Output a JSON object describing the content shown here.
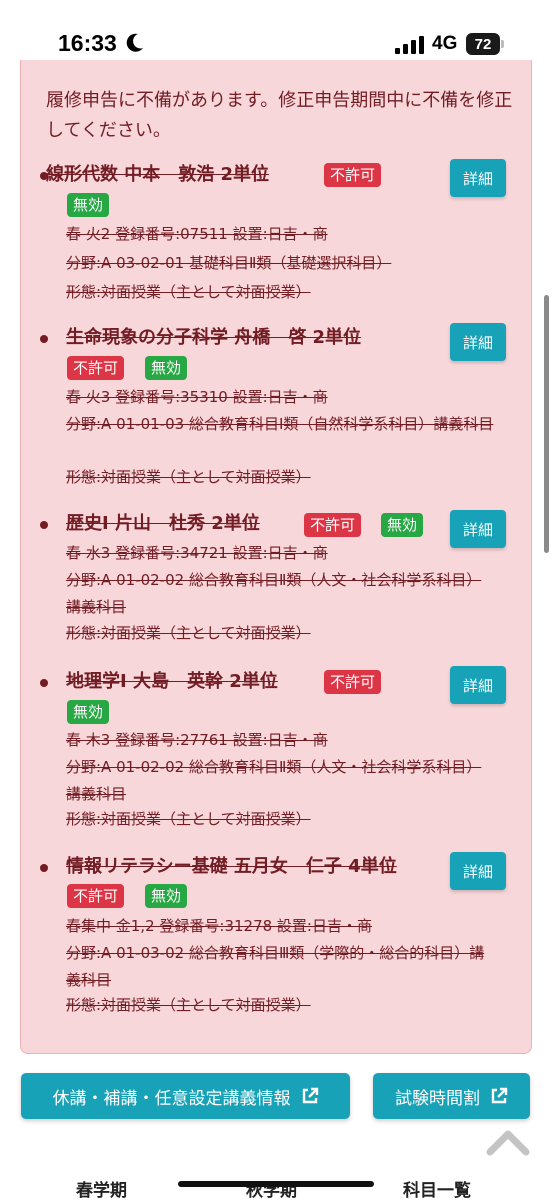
{
  "status_bar": {
    "time": "16:33",
    "network": "4G",
    "battery": "72"
  },
  "alert": {
    "message": "履修申告に不備があります。修正申告期間中に不備を修正してください。"
  },
  "courses": [
    {
      "title": "線形代数  中本　敦浩  2単位",
      "badges": [
        "不許可",
        "無効"
      ],
      "detail": "詳細",
      "lines": [
        "春  火2  登録番号:07511  設置:日吉・商",
        "分野:A 03-02-01 基礎科目Ⅱ類（基礎選択科目）",
        "形態:対面授業（主として対面授業）"
      ]
    },
    {
      "title": "生命現象の分子科学  舟橋　啓  2単位",
      "badges": [
        "不許可",
        "無効"
      ],
      "detail": "詳細",
      "lines": [
        "春  火3  登録番号:35310  設置:日吉・商",
        "分野:A 01-01-03 総合教育科目Ⅰ類（自然科学系科目）講義科目",
        "形態:対面授業（主として対面授業）"
      ]
    },
    {
      "title": "歴史Ⅰ  片山　杜秀  2単位",
      "badges": [
        "不許可",
        "無効"
      ],
      "detail": "詳細",
      "lines": [
        "春  水3  登録番号:34721  設置:日吉・商",
        "分野:A 01-02-02 総合教育科目Ⅱ類（人文・社会科学系科目）講義科目",
        "形態:対面授業（主として対面授業）"
      ]
    },
    {
      "title": "地理学Ⅰ  大島　英幹  2単位",
      "badges": [
        "不許可",
        "無効"
      ],
      "detail": "詳細",
      "lines": [
        "春  木3  登録番号:27761  設置:日吉・商",
        "分野:A 01-02-02 総合教育科目Ⅱ類（人文・社会科学系科目）講義科目",
        "形態:対面授業（主として対面授業）"
      ]
    },
    {
      "title": "情報リテラシー基礎  五月女　仁子  4単位",
      "badges": [
        "不許可",
        "無効"
      ],
      "detail": "詳細",
      "lines": [
        "春集中  金1,2  登録番号:31278  設置:日吉・商",
        "分野:A 01-03-02 総合教育科目Ⅲ類（学際的・総合的科目）講義科目",
        "形態:対面授業（主として対面授業）"
      ]
    }
  ],
  "links": {
    "cancel_info": "休講・補講・任意設定講義情報",
    "exam_schedule": "試験時間割"
  },
  "tabs": [
    "春学期",
    "秋学期",
    "科目一覧"
  ],
  "icons": {
    "status": "moon-icon",
    "external": "external-link-icon",
    "scroll": "chevron-up-icon"
  },
  "colors": {
    "alert_bg": "#f8d7da",
    "alert_text": "#721c24",
    "danger": "#dc3545",
    "success": "#28a745",
    "info": "#17a2b8"
  }
}
